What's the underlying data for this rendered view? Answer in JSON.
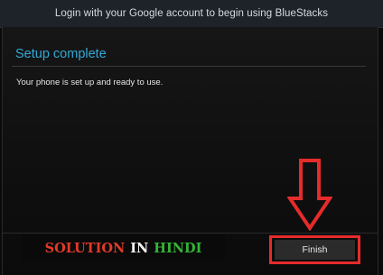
{
  "banner": {
    "text": "Login with your Google account to begin using BlueStacks"
  },
  "setup": {
    "title": "Setup complete",
    "message": "Your phone is set up and ready to use."
  },
  "overlay": {
    "brand_word_1": "SOLUTION",
    "brand_word_2": "IN",
    "brand_word_3": "HINDI",
    "highlight_color": "#e62b2b",
    "arrow_icon": "down-arrow-icon"
  },
  "actions": {
    "finish_label": "Finish"
  },
  "colors": {
    "title_blue": "#32a8d6",
    "brand_red": "#e23a2b",
    "brand_green": "#34b534"
  }
}
